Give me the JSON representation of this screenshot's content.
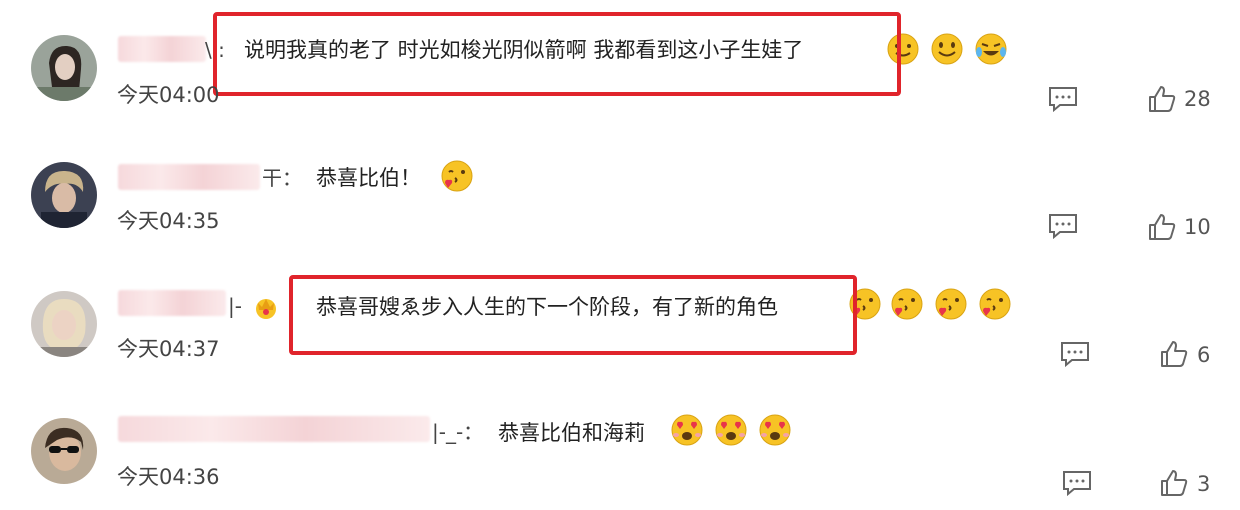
{
  "comments": [
    {
      "name_tail": "\\ :",
      "text": "说明我真的老了 时光如梭光阴似箭啊 我都看到这小子生娃了",
      "time": "今天04:00",
      "likes": "28",
      "emojis": [
        "smile-blush-icon",
        "smile-icon",
        "laugh-cry-icon"
      ]
    },
    {
      "name_tail": "干：",
      "text": "恭喜比伯！",
      "time": "今天04:35",
      "likes": "10",
      "emojis": [
        "kiss-heart-icon"
      ]
    },
    {
      "name_tail": "|-",
      "text": "恭喜哥嫂ゑ步入人生的下一个阶段，有了新的角色",
      "time": "今天04:37",
      "likes": "6",
      "emojis": [
        "kiss-heart-icon",
        "kiss-heart-icon",
        "kiss-heart-icon",
        "kiss-heart-icon"
      ]
    },
    {
      "name_tail": "|-_-：",
      "text": "恭喜比伯和海莉",
      "time": "今天04:36",
      "likes": "3",
      "emojis": [
        "heart-eyes-icon",
        "heart-eyes-icon",
        "heart-eyes-icon"
      ]
    }
  ],
  "colors": {
    "highlight": "#e0242b",
    "emoji": "#f7c325"
  }
}
